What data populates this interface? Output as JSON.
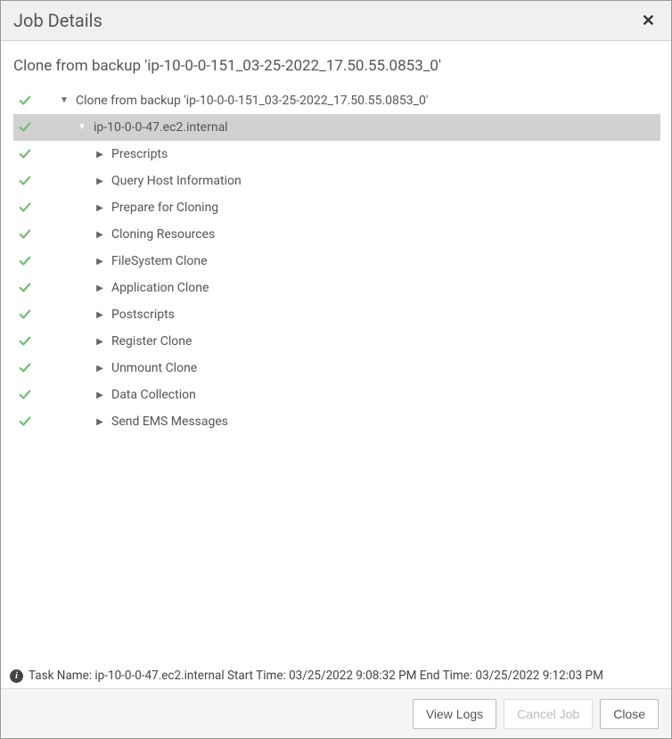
{
  "header": {
    "title": "Job Details"
  },
  "subtitle": "Clone from backup 'ip-10-0-0-151_03-25-2022_17.50.55.0853_0'",
  "tree": {
    "root": {
      "label": "Clone from backup 'ip-10-0-0-151_03-25-2022_17.50.55.0853_0'"
    },
    "host": {
      "label": "ip-10-0-0-47.ec2.internal"
    },
    "steps": [
      {
        "label": "Prescripts"
      },
      {
        "label": "Query Host Information"
      },
      {
        "label": "Prepare for Cloning"
      },
      {
        "label": "Cloning Resources"
      },
      {
        "label": "FileSystem Clone"
      },
      {
        "label": "Application Clone"
      },
      {
        "label": "Postscripts"
      },
      {
        "label": "Register Clone"
      },
      {
        "label": "Unmount Clone"
      },
      {
        "label": "Data Collection"
      },
      {
        "label": "Send EMS Messages"
      }
    ]
  },
  "status_bar": {
    "text": "Task Name: ip-10-0-0-47.ec2.internal Start Time: 03/25/2022 9:08:32 PM End Time: 03/25/2022 9:12:03 PM"
  },
  "footer": {
    "view_logs": "View Logs",
    "cancel_job": "Cancel Job",
    "close": "Close"
  }
}
